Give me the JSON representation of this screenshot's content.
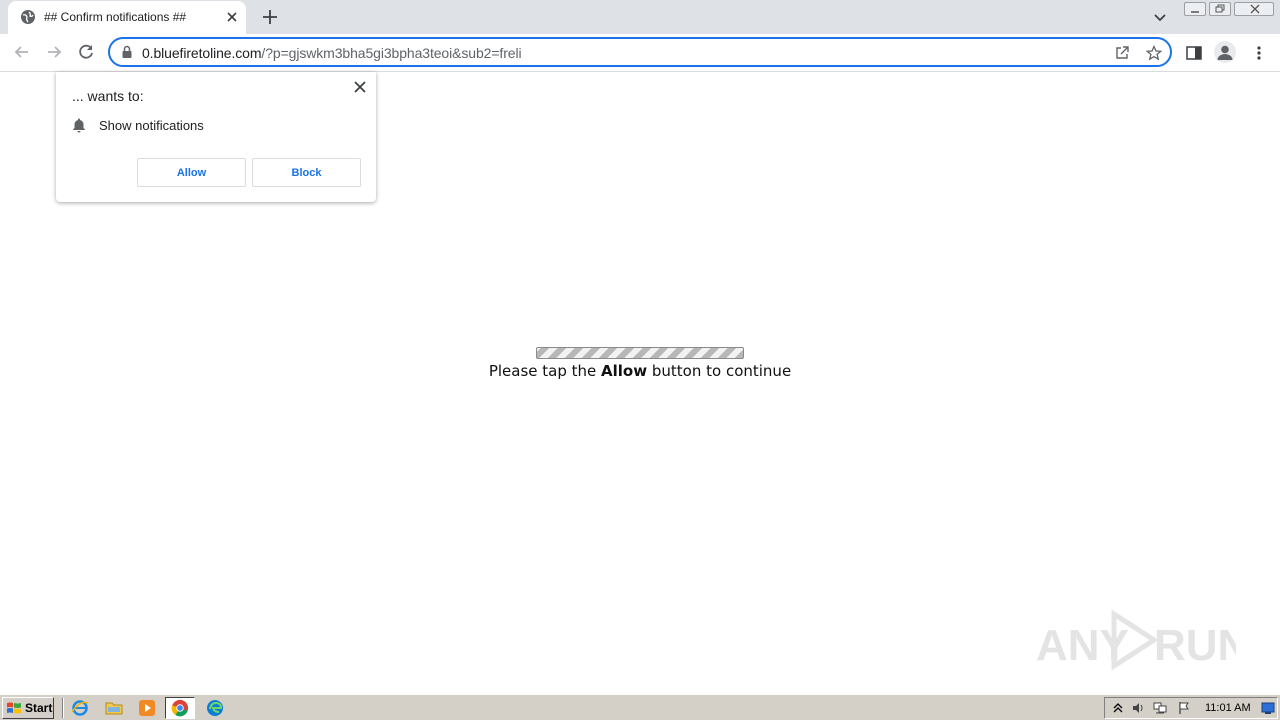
{
  "tab": {
    "title": "## Confirm notifications ##"
  },
  "address_bar": {
    "host": "0.bluefiretoline.com",
    "path": "/?p=gjswkm3bha5gi3bpha3teoi&sub2=freli"
  },
  "permission_popup": {
    "origin": "... wants to:",
    "permission": "Show notifications",
    "allow_label": "Allow",
    "block_label": "Block"
  },
  "page": {
    "message_before": "Please tap the",
    "message_bold": "Allow",
    "message_after": "button to continue"
  },
  "watermark": {
    "text_left": "ANY",
    "text_right": "RUN"
  },
  "taskbar": {
    "start_label": "Start",
    "clock": "11:01 AM"
  },
  "colors": {
    "accent": "#1a73e8",
    "tabstrip": "#dee1e6",
    "taskbar": "#d4d0c8"
  },
  "icons": [
    "globe-icon",
    "close-icon",
    "plus-icon",
    "chevron-down-icon",
    "back-arrow-icon",
    "forward-arrow-icon",
    "reload-icon",
    "lock-icon",
    "share-icon",
    "star-icon",
    "side-panel-icon",
    "profile-icon",
    "more-vert-icon",
    "bell-icon"
  ]
}
